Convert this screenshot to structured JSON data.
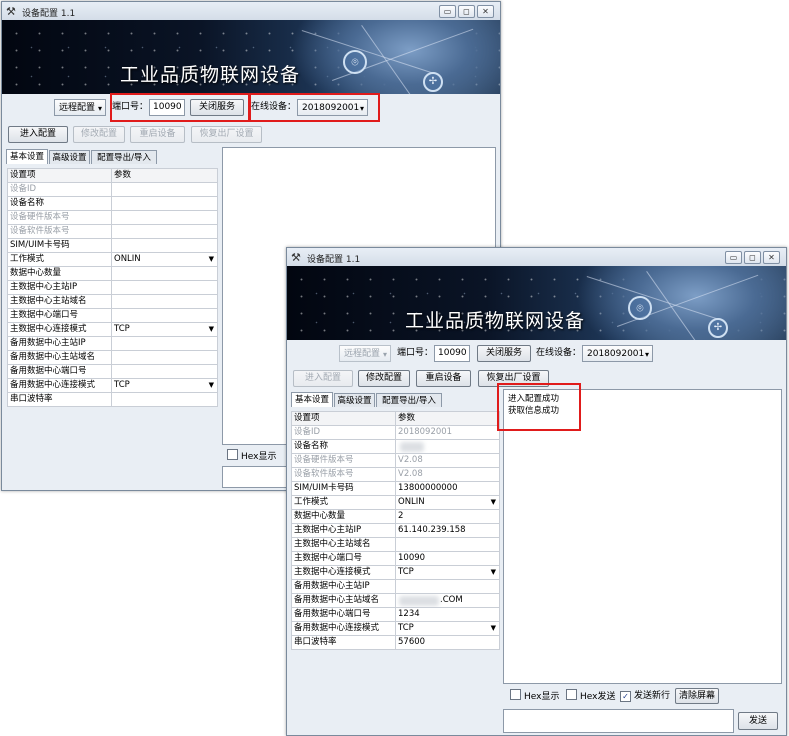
{
  "win1": {
    "title": "设备配置 1.1",
    "banner_title": "工业品质物联网设备",
    "toolbar": {
      "mode": "远程配置",
      "port_label": "端口号：",
      "port_value": "10090",
      "service_button": "关闭服务",
      "device_label": "在线设备：",
      "device_value": "2018092001"
    },
    "actions": [
      "进入配置",
      "修改配置",
      "重启设备",
      "恢复出厂设置"
    ],
    "tabs": [
      "基本设置",
      "高级设置",
      "配置导出/导入"
    ],
    "table": {
      "headers": [
        "设置项",
        "参数"
      ],
      "rows": [
        {
          "name": "设备ID",
          "value": ""
        },
        {
          "name": "设备名称",
          "value": ""
        },
        {
          "name": "设备硬件版本号",
          "value": ""
        },
        {
          "name": "设备软件版本号",
          "value": ""
        },
        {
          "name": "SIM/UIM卡号码",
          "value": ""
        },
        {
          "name": "工作模式",
          "value": "ONLIN"
        },
        {
          "name": "数据中心数量",
          "value": ""
        },
        {
          "name": "主数据中心主站IP",
          "value": ""
        },
        {
          "name": "主数据中心主站域名",
          "value": ""
        },
        {
          "name": "主数据中心端口号",
          "value": ""
        },
        {
          "name": "主数据中心连接模式",
          "value": "TCP"
        },
        {
          "name": "备用数据中心主站IP",
          "value": ""
        },
        {
          "name": "备用数据中心主站域名",
          "value": ""
        },
        {
          "name": "备用数据中心端口号",
          "value": ""
        },
        {
          "name": "备用数据中心连接模式",
          "value": "TCP"
        },
        {
          "name": "串口波特率",
          "value": ""
        }
      ]
    },
    "hex_display": "Hex显示"
  },
  "win2": {
    "title": "设备配置 1.1",
    "banner_title": "工业品质物联网设备",
    "toolbar": {
      "mode": "远程配置",
      "port_label": "端口号：",
      "port_value": "10090",
      "service_button": "关闭服务",
      "device_label": "在线设备：",
      "device_value": "2018092001"
    },
    "actions": [
      "进入配置",
      "修改配置",
      "重启设备",
      "恢复出厂设置"
    ],
    "tabs": [
      "基本设置",
      "高级设置",
      "配置导出/导入"
    ],
    "table": {
      "headers": [
        "设置项",
        "参数"
      ],
      "rows": [
        {
          "name": "设备ID",
          "value": "2018092001"
        },
        {
          "name": "设备名称",
          "value": ""
        },
        {
          "name": "设备硬件版本号",
          "value": "V2.08"
        },
        {
          "name": "设备软件版本号",
          "value": "V2.08"
        },
        {
          "name": "SIM/UIM卡号码",
          "value": "13800000000"
        },
        {
          "name": "工作模式",
          "value": "ONLIN"
        },
        {
          "name": "数据中心数量",
          "value": "2"
        },
        {
          "name": "主数据中心主站IP",
          "value": "61.140.239.158"
        },
        {
          "name": "主数据中心主站域名",
          "value": ""
        },
        {
          "name": "主数据中心端口号",
          "value": "10090"
        },
        {
          "name": "主数据中心连接模式",
          "value": "TCP"
        },
        {
          "name": "备用数据中心主站IP",
          "value": ""
        },
        {
          "name": "备用数据中心主站域名",
          "value": ".COM"
        },
        {
          "name": "备用数据中心端口号",
          "value": "1234"
        },
        {
          "name": "备用数据中心连接模式",
          "value": "TCP"
        },
        {
          "name": "串口波特率",
          "value": "57600"
        }
      ]
    },
    "log": [
      "进入配置成功",
      "获取信息成功"
    ],
    "options": {
      "hex_display": "Hex显示",
      "hex_send": "Hex发送",
      "send_newline": "发送新行",
      "send_newline_checked": true,
      "clear_button": "清除屏幕"
    },
    "send_button": "发送"
  }
}
